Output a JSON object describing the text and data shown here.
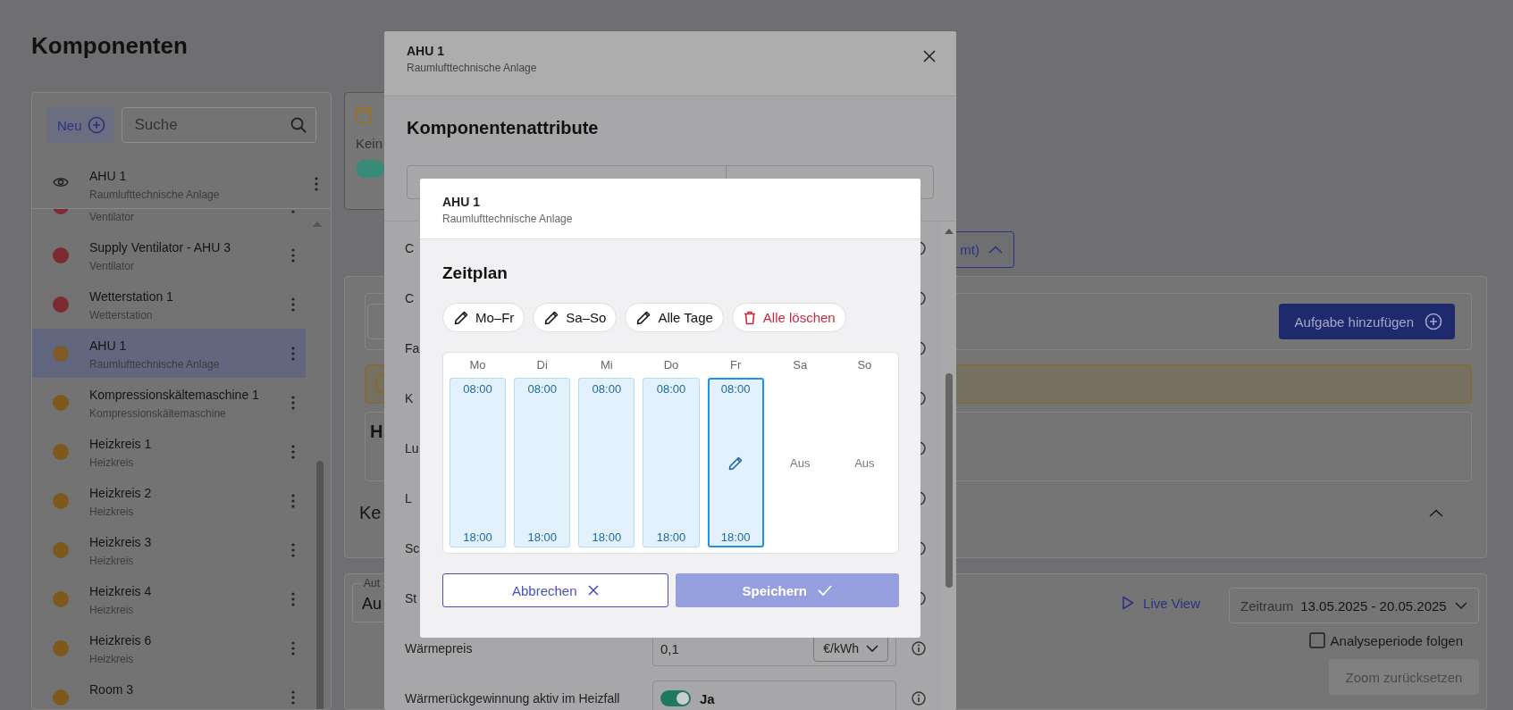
{
  "page_title": "Komponenten",
  "sidebar": {
    "new_button": "Neu",
    "search": {
      "placeholder": "Suche"
    },
    "pinned": {
      "title": "AHU 1",
      "subtitle": "Raumlufttechnische Anlage"
    },
    "items": [
      {
        "subtitle": "Ventilator",
        "color": "#7e2a31",
        "selected": false
      },
      {
        "title": "Supply Ventilator - AHU 3",
        "subtitle": "Ventilator",
        "color": "#7e2a31",
        "selected": false
      },
      {
        "title": "Wetterstation 1",
        "subtitle": "Wetterstation",
        "color": "#7e2a31",
        "selected": false
      },
      {
        "title": "AHU 1",
        "subtitle": "Raumlufttechnische Anlage",
        "color": "#7d5a28",
        "selected": true
      },
      {
        "title": "Kompressionskältemaschine 1",
        "subtitle": "Kompressionskältemaschine",
        "color": "#7d5a1c",
        "selected": false
      },
      {
        "title": "Heizkreis 1",
        "subtitle": "Heizkreis",
        "color": "#7d5a1c",
        "selected": false
      },
      {
        "title": "Heizkreis 2",
        "subtitle": "Heizkreis",
        "color": "#7d5a1c",
        "selected": false
      },
      {
        "title": "Heizkreis 3",
        "subtitle": "Heizkreis",
        "color": "#7d5a1c",
        "selected": false
      },
      {
        "title": "Heizkreis 4",
        "subtitle": "Heizkreis",
        "color": "#7d5a1c",
        "selected": false
      },
      {
        "title": "Heizkreis 6",
        "subtitle": "Heizkreis",
        "color": "#7d5a1c",
        "selected": false
      },
      {
        "title": "Room 3",
        "color": "#7d5a1c",
        "selected": false
      }
    ]
  },
  "content": {
    "schedule_card": {
      "text": "Kein",
      "toggle_on": true
    },
    "collapse_button": "mt)",
    "task_button": "Aufgabe hinzufügen",
    "box_heading": "H",
    "section_heading": "Ke",
    "select": {
      "label": "Aut",
      "value": "Au"
    },
    "live_view": "Live View",
    "period": {
      "label": "Zeitraum",
      "value": "13.05.2025 - 20.05.2025"
    },
    "follow_checkbox": {
      "label": "Analyseperiode folgen",
      "checked": false
    },
    "zoom_reset": {
      "label": "Zoom zurücksetzen",
      "disabled": true
    }
  },
  "attributes_dialog": {
    "title": "AHU 1",
    "subtitle": "Raumlufttechnische Anlage",
    "heading": "Komponentenattribute",
    "rows": [
      {
        "label": "C",
        "kind": "hidden"
      },
      {
        "label": "C",
        "kind": "hidden"
      },
      {
        "label": "Fa",
        "kind": "hidden"
      },
      {
        "label": "K",
        "kind": "hidden"
      },
      {
        "label": "Lu",
        "kind": "hidden"
      },
      {
        "label": "L",
        "kind": "hidden"
      },
      {
        "label": "Sc",
        "kind": "hidden"
      },
      {
        "label": "St",
        "kind": "hidden"
      },
      {
        "label": "Wärmepreis",
        "kind": "unit",
        "value": "0,1",
        "unit": "€/kWh"
      },
      {
        "label": "Wärmerückgewinnung aktiv im Heizfall",
        "kind": "toggle",
        "on": true,
        "value": "Ja"
      }
    ]
  },
  "schedule_dialog": {
    "title": "AHU 1",
    "subtitle": "Raumlufttechnische Anlage",
    "heading": "Zeitplan",
    "presets": [
      {
        "label": "Mo–Fr",
        "kind": "edit"
      },
      {
        "label": "Sa–So",
        "kind": "edit"
      },
      {
        "label": "Alle Tage",
        "kind": "edit"
      },
      {
        "label": "Alle löschen",
        "kind": "delete"
      }
    ],
    "days": [
      {
        "name": "Mo",
        "on": true,
        "start": "08:00",
        "end": "18:00",
        "selected": false
      },
      {
        "name": "Di",
        "on": true,
        "start": "08:00",
        "end": "18:00",
        "selected": false
      },
      {
        "name": "Mi",
        "on": true,
        "start": "08:00",
        "end": "18:00",
        "selected": false
      },
      {
        "name": "Do",
        "on": true,
        "start": "08:00",
        "end": "18:00",
        "selected": false
      },
      {
        "name": "Fr",
        "on": true,
        "start": "08:00",
        "end": "18:00",
        "selected": true
      },
      {
        "name": "Sa",
        "on": false,
        "off_label": "Aus",
        "selected": false
      },
      {
        "name": "So",
        "on": false,
        "off_label": "Aus",
        "selected": false
      }
    ],
    "cancel": "Abbrechen",
    "save": {
      "label": "Speichern",
      "disabled": true
    }
  }
}
